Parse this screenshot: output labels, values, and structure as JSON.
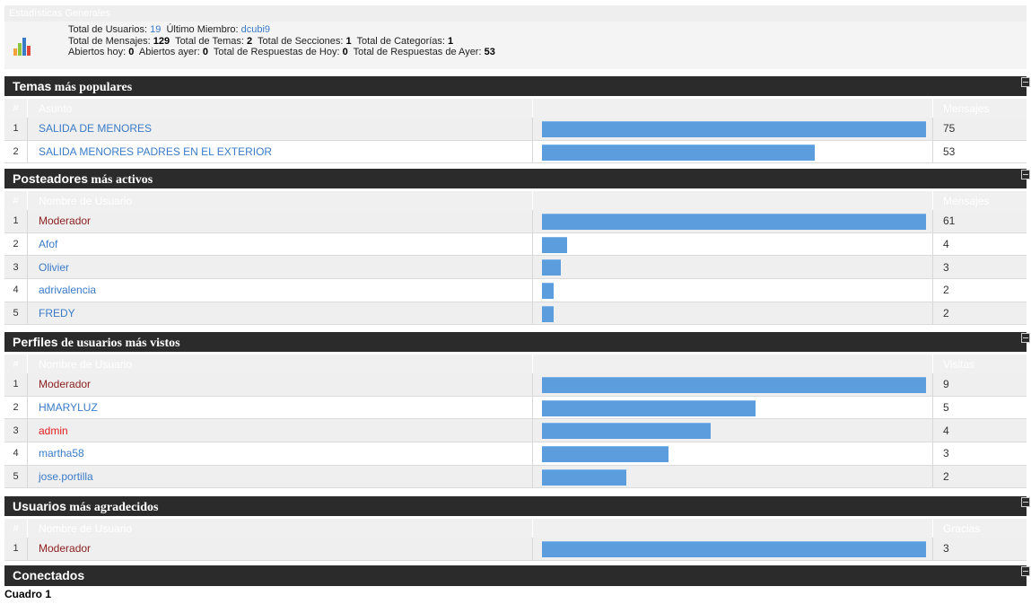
{
  "general": {
    "title": "Estadísticas Generales",
    "icon": "bar-chart-icon",
    "line1": {
      "users_label": "Total de Usuarios:",
      "users_value": "19",
      "last_member_label": "Último Miembro:",
      "last_member_value": "dcubi9"
    },
    "line2": {
      "messages_label": "Total de Mensajes:",
      "messages_value": "129",
      "topics_label": "Total de Temas:",
      "topics_value": "2",
      "sections_label": "Total de Secciones:",
      "sections_value": "1",
      "categories_label": "Total de Categorías:",
      "categories_value": "1"
    },
    "line3": {
      "open_today_label": "Abiertos hoy:",
      "open_today_value": "0",
      "open_yesterday_label": "Abiertos ayer:",
      "open_yesterday_value": "0",
      "replies_today_label": "Total de Respuestas de Hoy:",
      "replies_today_value": "0",
      "replies_yesterday_label": "Total de Respuestas de Ayer:",
      "replies_yesterday_value": "53"
    }
  },
  "sections": [
    {
      "title_a": "Temas",
      "title_b": "más populares",
      "headers": {
        "num": "#",
        "name": "Asunto",
        "value": "Mensajes"
      },
      "rows": [
        {
          "num": "1",
          "name": "SALIDA DE MENORES",
          "value": "75",
          "ratio": 1.0,
          "style": "link"
        },
        {
          "num": "2",
          "name": "SALIDA MENORES PADRES EN EL EXTERIOR",
          "value": "53",
          "ratio": 0.71,
          "style": "link"
        }
      ]
    },
    {
      "title_a": "Posteadores",
      "title_b": "más activos",
      "headers": {
        "num": "#",
        "name": "Nombre de Usuario",
        "value": "Mensajes"
      },
      "rows": [
        {
          "num": "1",
          "name": "Moderador",
          "value": "61",
          "ratio": 1.0,
          "style": "mod"
        },
        {
          "num": "2",
          "name": "Afof",
          "value": "4",
          "ratio": 0.066,
          "style": "link"
        },
        {
          "num": "3",
          "name": "Olivier",
          "value": "3",
          "ratio": 0.049,
          "style": "link"
        },
        {
          "num": "4",
          "name": "adrivalencia",
          "value": "2",
          "ratio": 0.03,
          "style": "link"
        },
        {
          "num": "5",
          "name": "FREDY",
          "value": "2",
          "ratio": 0.03,
          "style": "link"
        }
      ]
    },
    {
      "title_a": "Perfiles",
      "title_b": "de usuarios más vistos",
      "headers": {
        "num": "#",
        "name": "Nombre de Usuario",
        "value": "Visitas"
      },
      "rows": [
        {
          "num": "1",
          "name": "Moderador",
          "value": "9",
          "ratio": 1.0,
          "style": "mod"
        },
        {
          "num": "2",
          "name": "HMARYLUZ",
          "value": "5",
          "ratio": 0.556,
          "style": "link"
        },
        {
          "num": "3",
          "name": "admin",
          "value": "4",
          "ratio": 0.44,
          "style": "admin"
        },
        {
          "num": "4",
          "name": "martha58",
          "value": "3",
          "ratio": 0.33,
          "style": "link"
        },
        {
          "num": "5",
          "name": "jose.portilla",
          "value": "2",
          "ratio": 0.22,
          "style": "link"
        }
      ]
    },
    {
      "title_a": "Usuarios",
      "title_b": "más agradecidos",
      "headers": {
        "num": "#",
        "name": "Nombre de Usuario",
        "value": "Gracias"
      },
      "rows": [
        {
          "num": "1",
          "name": "Moderador",
          "value": "3",
          "ratio": 1.0,
          "style": "mod"
        }
      ]
    },
    {
      "title_a": "Conectados",
      "title_b": "",
      "headers": null,
      "rows": []
    }
  ],
  "caption": "Cuadro 1"
}
